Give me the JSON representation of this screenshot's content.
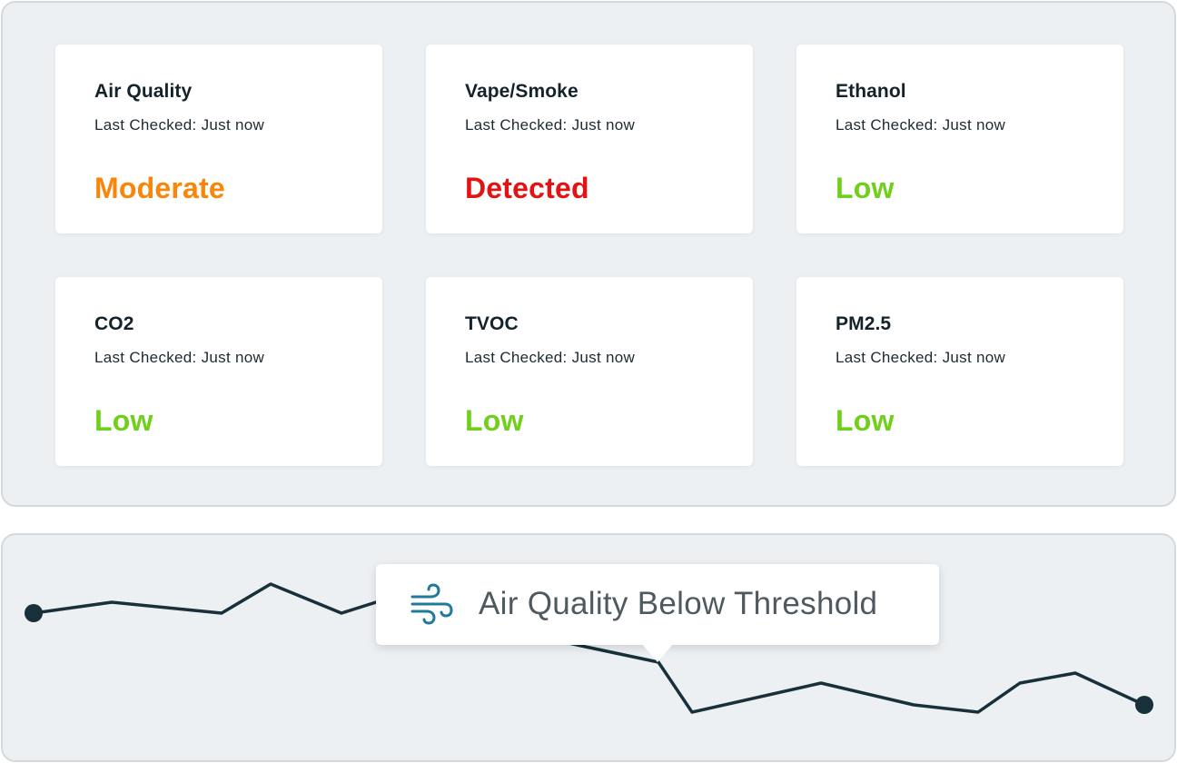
{
  "cards": [
    {
      "title": "Air Quality",
      "subtitle": "Last Checked: Just now",
      "status": "Moderate",
      "status_color": "#f7860b"
    },
    {
      "title": "Vape/Smoke",
      "subtitle": "Last Checked: Just now",
      "status": "Detected",
      "status_color": "#e31313"
    },
    {
      "title": "Ethanol",
      "subtitle": "Last Checked: Just now",
      "status": "Low",
      "status_color": "#6fcf1b"
    },
    {
      "title": "CO2",
      "subtitle": "Last Checked: Just now",
      "status": "Low",
      "status_color": "#6fcf1b"
    },
    {
      "title": "TVOC",
      "subtitle": "Last Checked: Just now",
      "status": "Low",
      "status_color": "#6fcf1b"
    },
    {
      "title": "PM2.5",
      "subtitle": "Last Checked: Just now",
      "status": "Low",
      "status_color": "#6fcf1b"
    }
  ],
  "alert": {
    "icon": "wind-icon",
    "text": "Air Quality Below Threshold",
    "icon_color": "#1f7a9c"
  },
  "colors": {
    "line": "#17303a",
    "panel_background": "#edf0f3"
  }
}
